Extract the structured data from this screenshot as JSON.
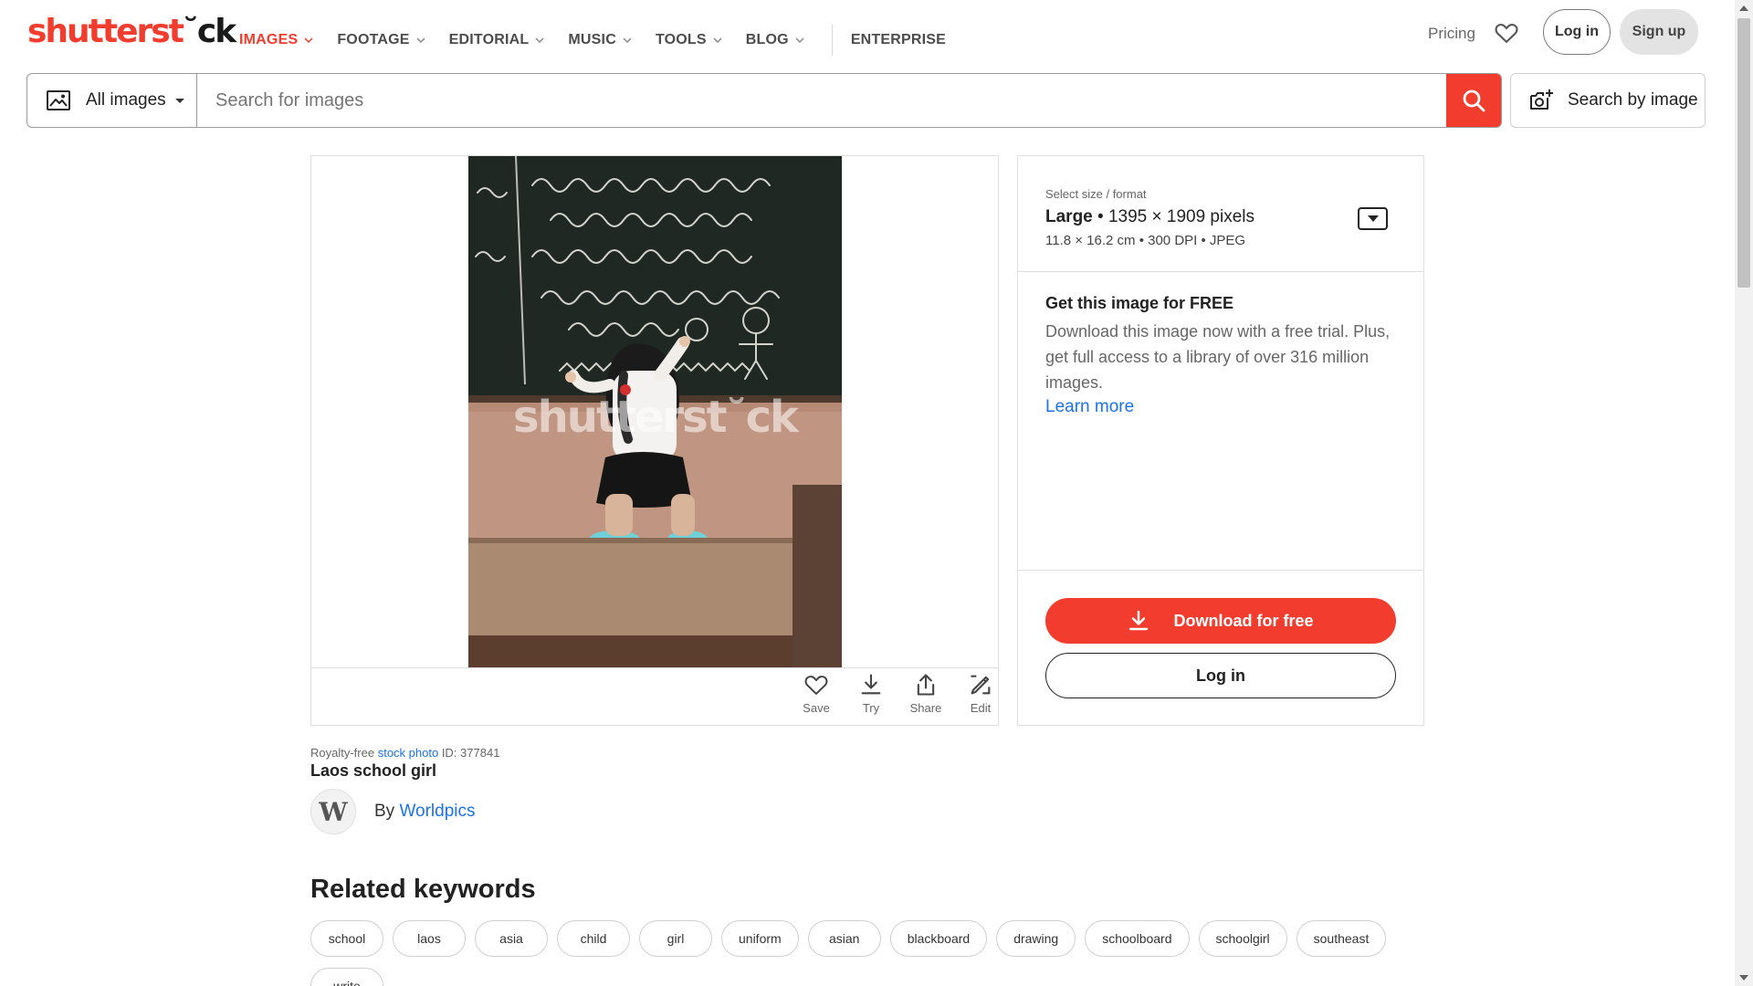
{
  "brand": {
    "logo_prefix": "shutterst",
    "logo_mark": "˘",
    "logo_suffix": "ck",
    "accent": "#f23d2e"
  },
  "nav": {
    "items": [
      {
        "label": "IMAGES",
        "active": true
      },
      {
        "label": "FOOTAGE"
      },
      {
        "label": "EDITORIAL"
      },
      {
        "label": "MUSIC"
      },
      {
        "label": "TOOLS"
      },
      {
        "label": "BLOG"
      }
    ],
    "enterprise": "ENTERPRISE",
    "pricing": "Pricing",
    "login": "Log in",
    "signup": "Sign up"
  },
  "search": {
    "type_label": "All images",
    "placeholder": "Search for images",
    "by_image_label": "Search by image"
  },
  "image": {
    "watermark": "shutterst˘ck",
    "actions": [
      {
        "label": "Save",
        "icon": "heart-icon"
      },
      {
        "label": "Try",
        "icon": "download-icon"
      },
      {
        "label": "Share",
        "icon": "share-icon"
      },
      {
        "label": "Edit",
        "icon": "edit-icon"
      }
    ]
  },
  "license": {
    "select_label": "Select size / format",
    "size_name": "Large",
    "size_pixels": " • 1395 × 1909 pixels",
    "size_details": "11.8 × 16.2 cm • 300 DPI • JPEG",
    "free_title": "Get this image for FREE",
    "free_text": "Download this image now with a free trial. Plus, get full access to a library of over 316 million images.",
    "learn_more": "Learn more",
    "download_label": "Download for free",
    "login_label": "Log in"
  },
  "info": {
    "meta_prefix": "Royalty-free ",
    "meta_link": "stock photo",
    "meta_id": " ID: 377841",
    "title": "Laos school girl",
    "avatar_letter": "W",
    "by_prefix": "By ",
    "author": "Worldpics"
  },
  "related": {
    "title": "Related keywords",
    "keywords": [
      "school",
      "laos",
      "asia",
      "child",
      "girl",
      "uniform",
      "asian",
      "blackboard",
      "drawing",
      "schoolboard",
      "schoolgirl",
      "southeast",
      "write"
    ]
  }
}
